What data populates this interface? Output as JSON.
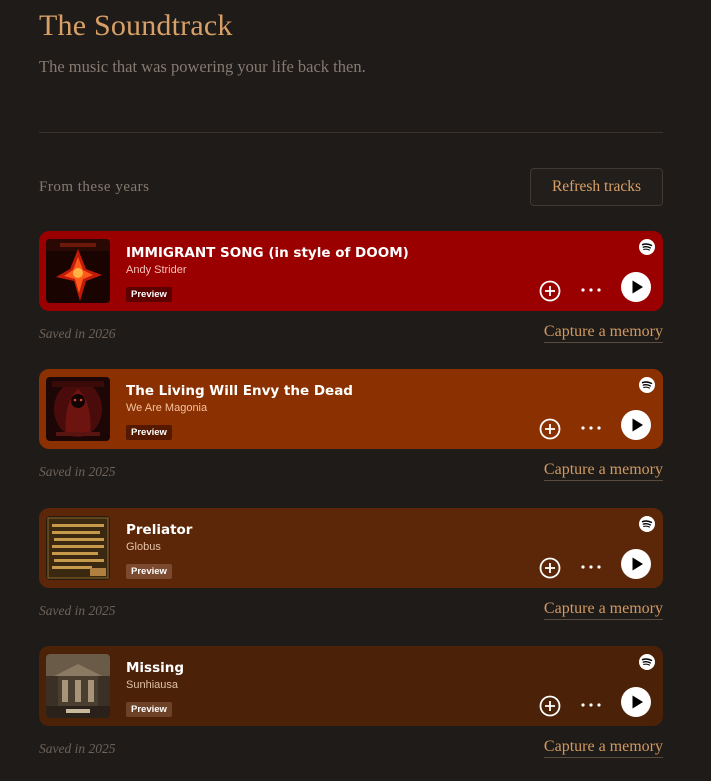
{
  "header": {
    "title": "The Soundtrack",
    "subtitle": "The music that was powering your life back then."
  },
  "section": {
    "label": "From these years",
    "refresh_label": "Refresh tracks"
  },
  "tracks": [
    {
      "title": "IMMIGRANT SONG (in style of DOOM)",
      "artist": "Andy Strider",
      "badge": "Preview",
      "saved": "Saved in 2026",
      "capture_label": "Capture a memory",
      "card_color": "#9b0000",
      "artist_color": "#f3c2b8",
      "badge_color": "#5c0000",
      "cover_icon": "doom-fire-album-art"
    },
    {
      "title": "The Living Will Envy the Dead",
      "artist": "We Are Magonia",
      "badge": "Preview",
      "saved": "Saved in 2025",
      "capture_label": "Capture a memory",
      "card_color": "#8b3000",
      "artist_color": "#f5c3a2",
      "badge_color": "#551800",
      "cover_icon": "reaper-album-art"
    },
    {
      "title": "Preliator",
      "artist": "Globus",
      "badge": "Preview",
      "saved": "Saved in 2025",
      "capture_label": "Capture a memory",
      "card_color": "#5c2708",
      "artist_color": "#e6c2a8",
      "badge_color": "#7c4a2e",
      "cover_icon": "runic-text-album-art"
    },
    {
      "title": "Missing",
      "artist": "Sunhiausa",
      "badge": "Preview",
      "saved": "Saved in 2025",
      "capture_label": "Capture a memory",
      "card_color": "#4b2108",
      "artist_color": "#e0c0a8",
      "badge_color": "#6e4226",
      "cover_icon": "temple-album-art"
    }
  ]
}
